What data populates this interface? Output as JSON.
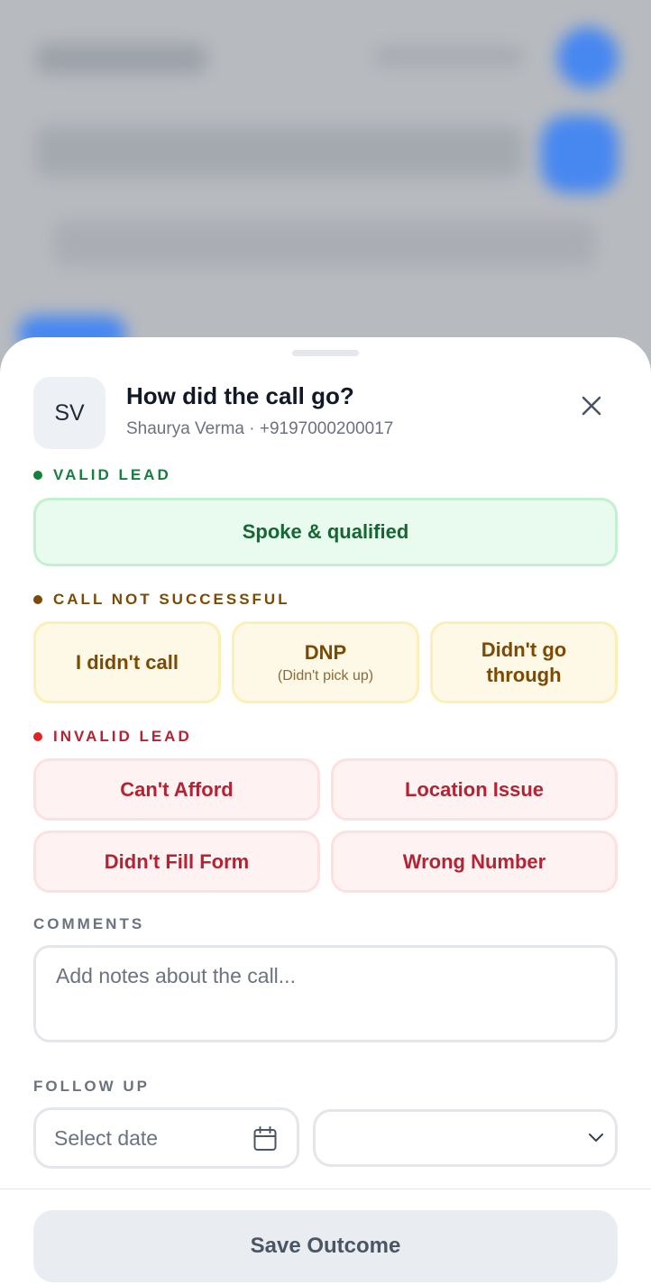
{
  "header": {
    "avatar_initials": "SV",
    "title": "How did the call go?",
    "contact_name": "Shaurya Verma",
    "separator": "·",
    "contact_phone": "+9197000200017"
  },
  "sections": {
    "valid": {
      "label": "VALID LEAD",
      "color": "#15803d",
      "options": [
        "Spoke & qualified"
      ]
    },
    "not_successful": {
      "label": "CALL NOT SUCCESSFUL",
      "color": "#7c4a03",
      "options": [
        {
          "label": "I didn't call"
        },
        {
          "label": "DNP",
          "sub": "(Didn't pick up)"
        },
        {
          "label": "Didn't go through"
        }
      ]
    },
    "invalid": {
      "label": "INVALID LEAD",
      "color": "#b42334",
      "options": [
        "Can't Afford",
        "Location Issue",
        "Didn't Fill Form",
        "Wrong Number"
      ]
    }
  },
  "comments": {
    "label": "COMMENTS",
    "placeholder": "Add notes about the call..."
  },
  "follow_up": {
    "label": "FOLLOW UP",
    "date_placeholder": "Select date",
    "time_value": ""
  },
  "actions": {
    "save_label": "Save Outcome"
  },
  "icons": {
    "close": "close-icon",
    "calendar": "calendar-icon",
    "chevron": "chevron-down-icon"
  }
}
